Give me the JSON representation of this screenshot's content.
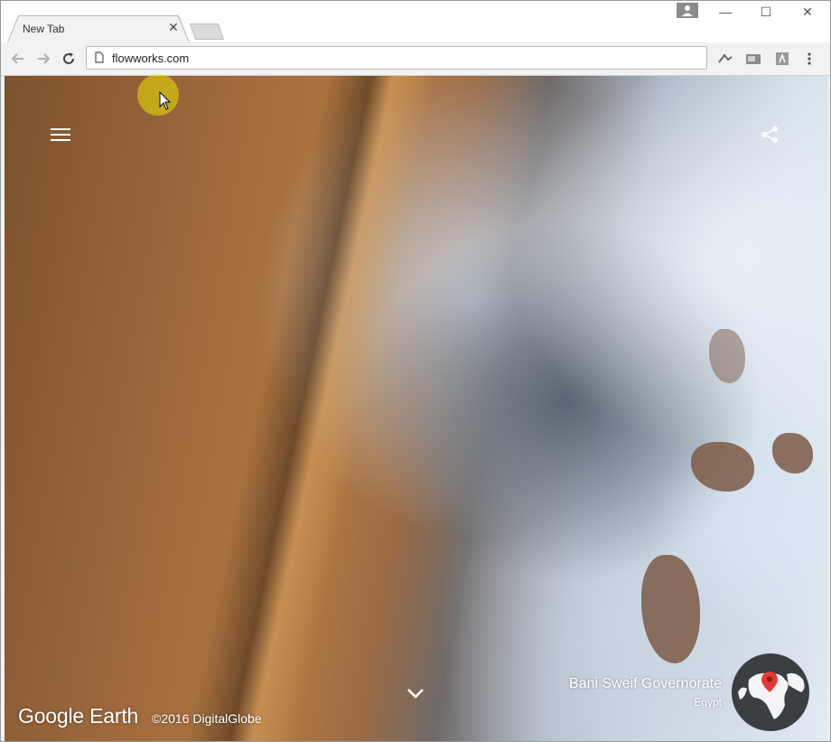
{
  "browser": {
    "tab_title": "New Tab",
    "tab_close": "✕",
    "url": "flowworks.com",
    "window_controls": {
      "minimize": "—",
      "maximize": "☐",
      "close": "✕"
    },
    "icons": [
      "back-icon",
      "forward-icon",
      "reload-icon",
      "page-icon",
      "extension-icon",
      "cast-icon",
      "pdf-icon",
      "menu-dots-icon",
      "profile-icon"
    ]
  },
  "earth": {
    "logo": "Google Earth",
    "copyright": "©2016 DigitalGlobe",
    "place_name": "Bani Sweif Governorate",
    "country": "Egypt",
    "icons": [
      "hamburger-icon",
      "share-icon",
      "chevron-down-icon",
      "globe-icon",
      "location-pin-icon"
    ],
    "colors": {
      "pin": "#e53935",
      "overlay_text": "#ffffff"
    }
  }
}
